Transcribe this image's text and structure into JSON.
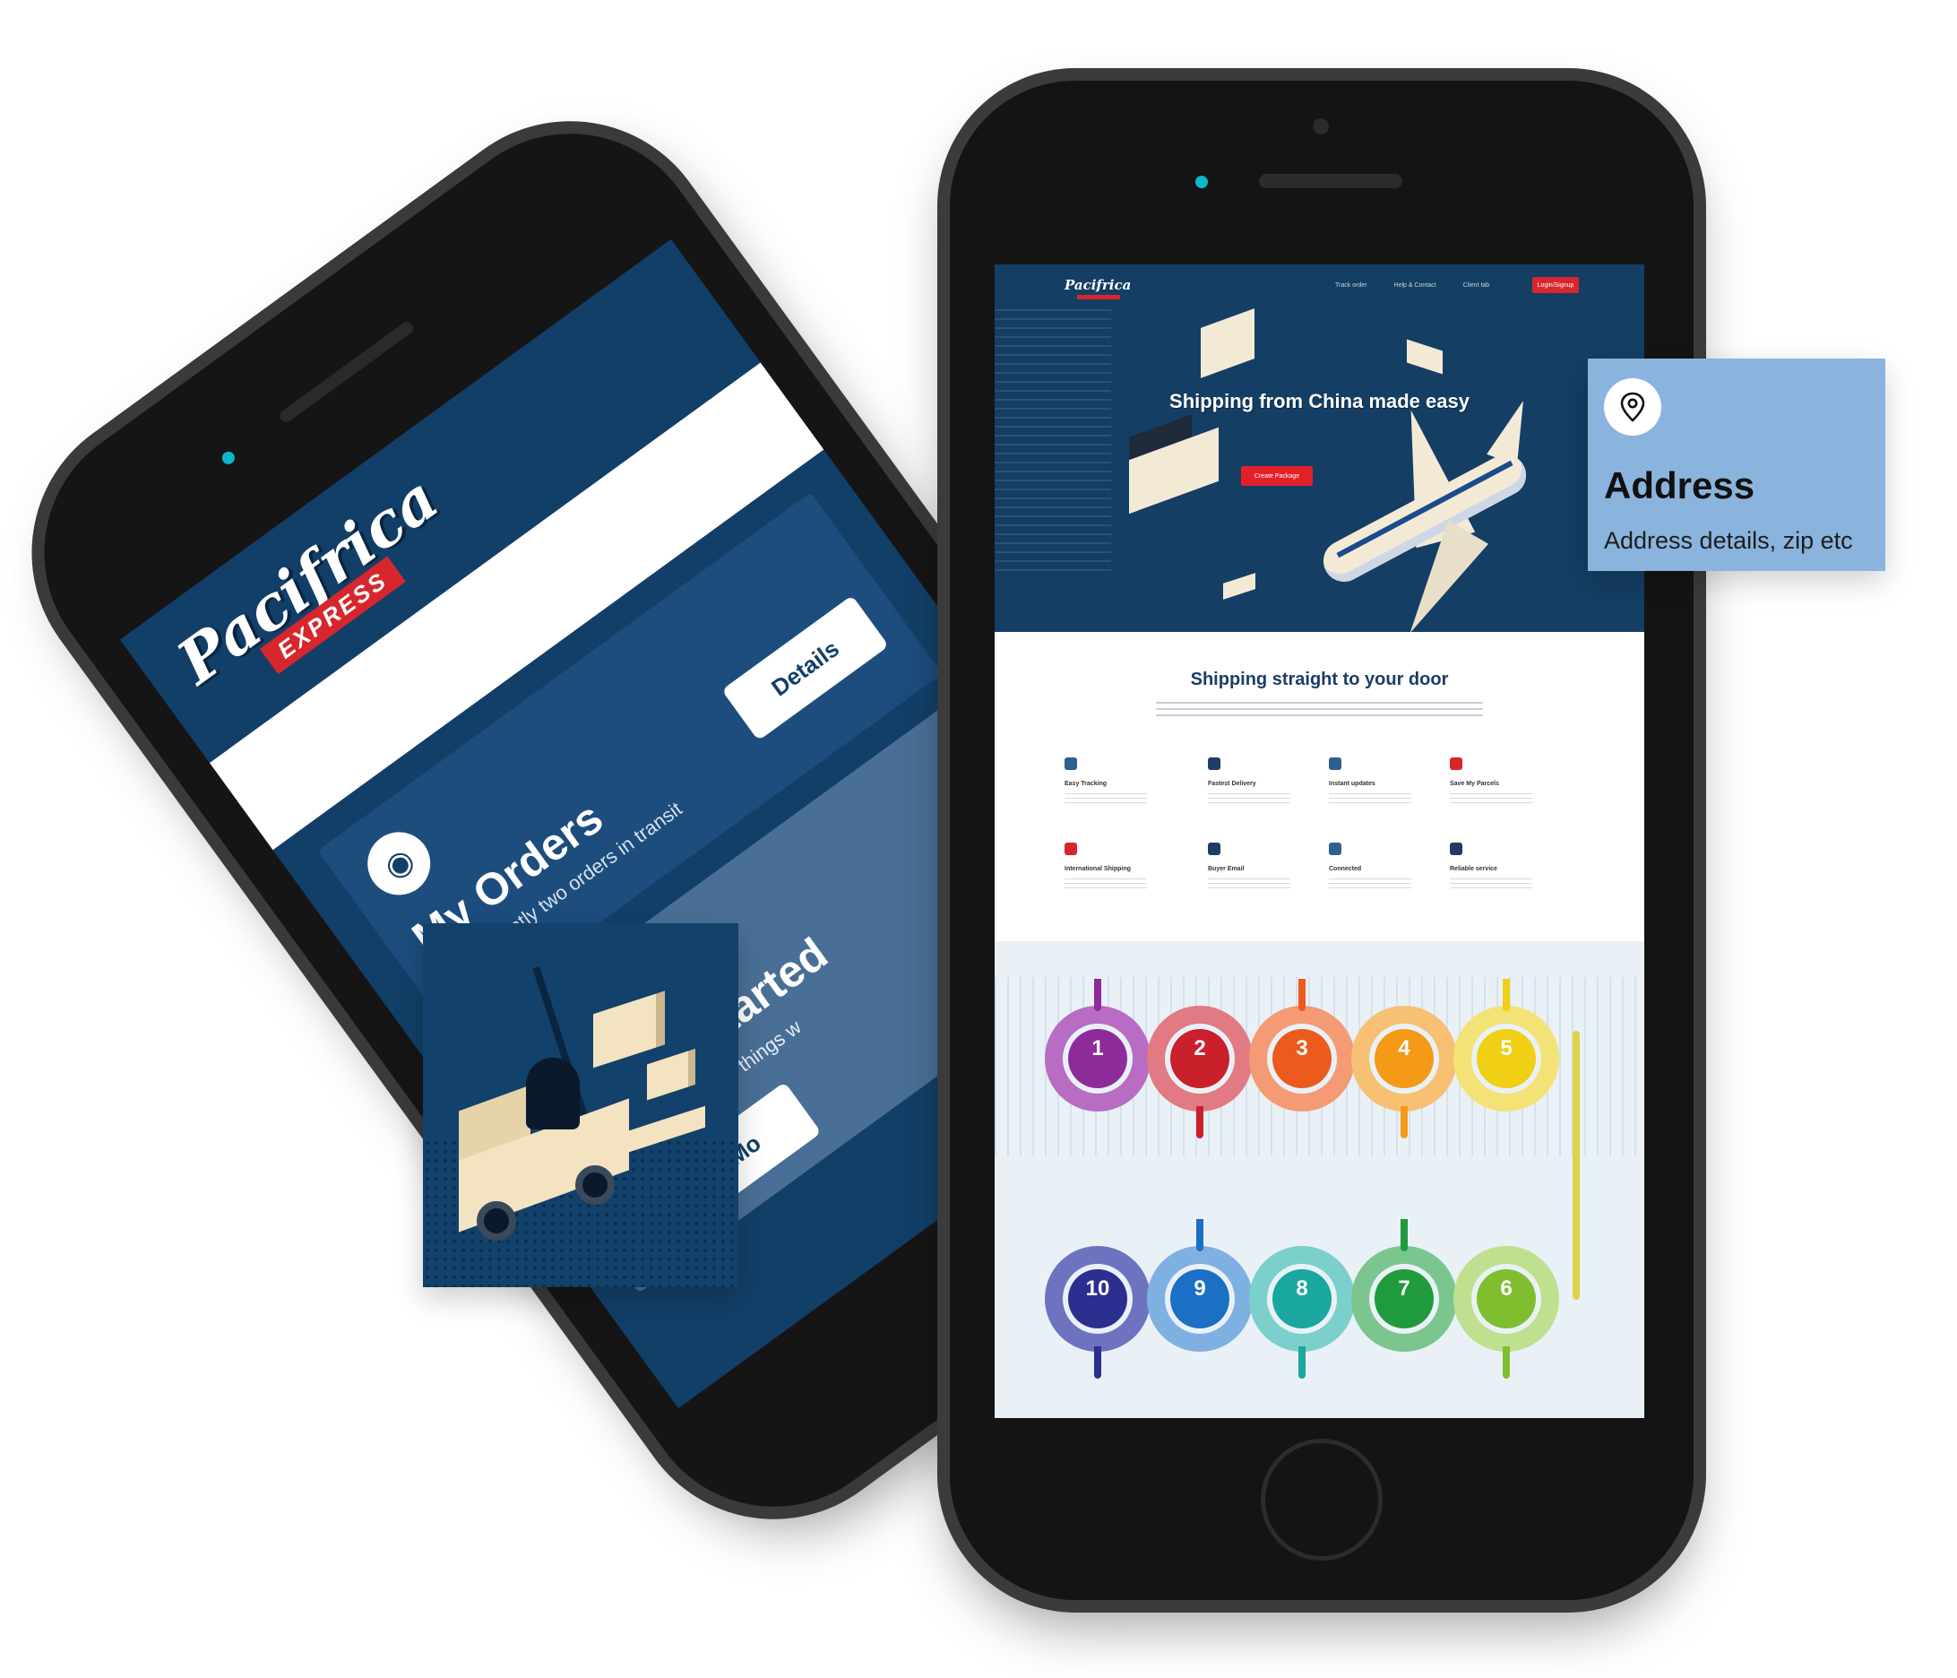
{
  "back_phone": {
    "logo_text": "Pacifrica",
    "logo_tag": "EXPRESS",
    "orders_card": {
      "title": "My Orders",
      "subtitle": "You currently two orders in transit",
      "button": "Details"
    },
    "getting_started_card": {
      "title": "Getting Started",
      "subtitle": "A quick view of \"How things w",
      "button": "Learn Mo"
    }
  },
  "front_phone": {
    "nav": {
      "logo": "Pacifrica",
      "links": [
        "Track order",
        "Help & Contact",
        "Client tab"
      ],
      "cta": "Login/Signup"
    },
    "hero": {
      "title": "Shipping from China made easy",
      "cta": "Create Package"
    },
    "features": {
      "title": "Shipping straight to your door",
      "items": [
        {
          "label": "Easy Tracking",
          "icon": "truck-icon",
          "color": "#2d5f8f"
        },
        {
          "label": "Fastest Delivery",
          "icon": "plane-icon",
          "color": "#1d3c66"
        },
        {
          "label": "Instant updates",
          "icon": "phone-icon",
          "color": "#2d5f8f"
        },
        {
          "label": "Save My Parcels",
          "icon": "box-icon",
          "color": "#d7262d"
        },
        {
          "label": "International Shipping",
          "icon": "globe-icon",
          "color": "#d7262d"
        },
        {
          "label": "Buyer Email",
          "icon": "mail-icon",
          "color": "#1d3c66"
        },
        {
          "label": "Connected",
          "icon": "link-icon",
          "color": "#2d5f8f"
        },
        {
          "label": "Reliable service",
          "icon": "shield-icon",
          "color": "#1d3c66"
        }
      ]
    },
    "process_steps": [
      {
        "number": "1",
        "color": "#8e2b9b"
      },
      {
        "number": "2",
        "color": "#c9202c"
      },
      {
        "number": "3",
        "color": "#ec5a1e"
      },
      {
        "number": "4",
        "color": "#f59a16"
      },
      {
        "number": "5",
        "color": "#f0cf14"
      },
      {
        "number": "6",
        "color": "#7fbf2f"
      },
      {
        "number": "7",
        "color": "#1f9a3c"
      },
      {
        "number": "8",
        "color": "#19a7a0"
      },
      {
        "number": "9",
        "color": "#1b6fc4"
      },
      {
        "number": "10",
        "color": "#2b2f8f"
      }
    ]
  },
  "address_card": {
    "icon": "location-pin-icon",
    "title": "Address",
    "subtitle": "Address details, zip etc"
  }
}
